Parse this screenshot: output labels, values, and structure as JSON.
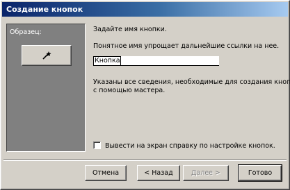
{
  "window": {
    "title": "Создание кнопок"
  },
  "preview": {
    "label": "Образец:",
    "button_icon": "wizard-wand-icon"
  },
  "prompt": "Задайте имя кнопки.",
  "hint": "Понятное имя упрощает дальнейшие ссылки на нее.",
  "name_input": {
    "value": "Кнопка"
  },
  "info": {
    "line1": "Указаны все сведения, необходимые для создания кнопки",
    "line2": "с помощью мастера."
  },
  "help_checkbox": {
    "label": "Вывести на экран справку по настройке кнопок.",
    "checked": false
  },
  "buttons": {
    "cancel": "Отмена",
    "back": "< Назад",
    "next": "Далее >",
    "finish": "Готово"
  }
}
